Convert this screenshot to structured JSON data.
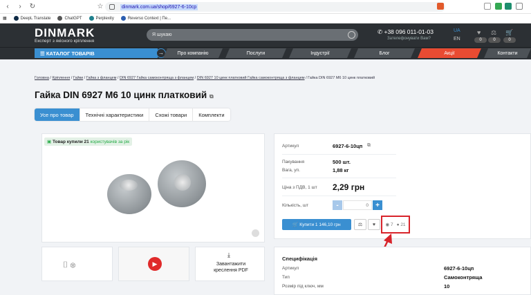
{
  "browser": {
    "url": "dinmark.com.ua/shop/6927-6-10cp"
  },
  "bookmarks": [
    {
      "label": "DeepL Translate",
      "color": "#0f2b46"
    },
    {
      "label": "ChatGPT",
      "color": "#555555"
    },
    {
      "label": "Perplexity",
      "color": "#20808d"
    },
    {
      "label": "Reverso Context | Пе...",
      "color": "#2a5db0"
    }
  ],
  "header": {
    "logo": "DINMARK",
    "tagline": "Експерт з якісного кріплення",
    "search_placeholder": "Я шукаю",
    "phone": "+38 096 011-01-03",
    "callback": "Зателефонувати Вам?",
    "lang_active": "UA",
    "lang_other": "EN",
    "badges": [
      "0",
      "0",
      "0"
    ]
  },
  "menu": {
    "catalog": "КАТАЛОГ ТОВАРІВ",
    "items": [
      "Про компанію",
      "Послуги",
      "Індустрії",
      "Блог",
      "Акції",
      "Контакти"
    ]
  },
  "breadcrumbs": {
    "items": [
      "Головна",
      "Кріплення",
      "Гайки",
      "Гайка з фланцем",
      "DIN 6927 Гайка самоконтряща з фланцем",
      "DIN 6927 10 цинк платковий Гайка самоконтряща з фланцем"
    ],
    "current": "Гайка DIN 6927 М6 10 цинк платковий"
  },
  "product": {
    "title": "Гайка DIN 6927 М6 10 цинк платковий",
    "tabs": [
      "Усе про товар",
      "Технічні характеристики",
      "Схожі товари",
      "Комплекти"
    ],
    "bought_prefix": "Товар купили 21",
    "bought_suffix": "користувачів за рік",
    "article_label": "Артикул",
    "article_value": "6927-6-10цп",
    "package_label": "Пакування",
    "package_value": "500 шт.",
    "weight_label": "Вага, уп.",
    "weight_value": "1,88 кг",
    "price_label": "Ціна з ПДВ, 1 шт",
    "price_value": "2,29 грн",
    "qty_label": "Кількість, шт",
    "qty_value": "0",
    "buy_label": "Купити 1 146,10 грн",
    "views": "7",
    "buyers": "21",
    "download_label": "Завантажити креслення PDF"
  },
  "spec": {
    "title": "Специфікація",
    "rows": [
      {
        "k": "Артикул",
        "v": "6927-6-10цп"
      },
      {
        "k": "Тип",
        "v": "Самоконтряща"
      },
      {
        "k": "Розмір під ключ, мм",
        "v": "10"
      }
    ]
  }
}
